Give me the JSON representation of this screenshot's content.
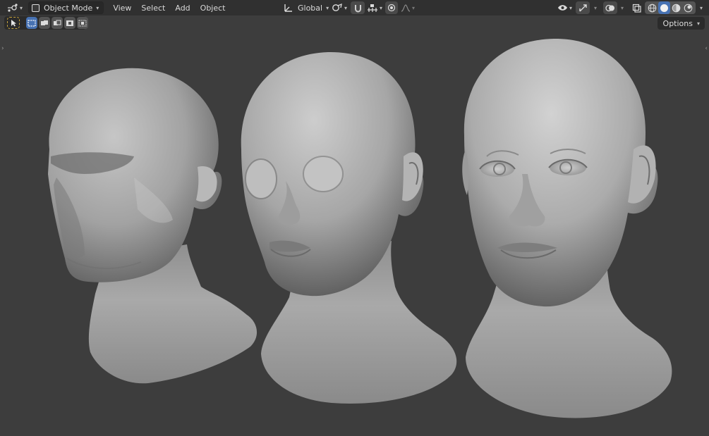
{
  "header": {
    "mode_label": "Object Mode",
    "menu": [
      "View",
      "Select",
      "Add",
      "Object"
    ],
    "transform_orientation": "Global",
    "icons": {
      "editor_type": "object-data-icon",
      "snap": "link-icon",
      "proportional": "circle-dot-icon",
      "visibility": "eye-icon",
      "gizmo": "gizmo-icon",
      "overlay": "overlay-icon",
      "xray": "xray-icon"
    },
    "shading_modes": [
      "wireframe",
      "solid",
      "material-preview",
      "rendered"
    ],
    "active_shading": "solid"
  },
  "toolbar": {
    "options_label": "Options",
    "select_modes": [
      "new",
      "extend",
      "subtract",
      "invert",
      "intersect"
    ]
  },
  "viewport": {
    "models": [
      "low-res-head",
      "mid-res-head",
      "high-res-head"
    ],
    "colors": {
      "background": "#3d3d3d",
      "header": "#303030",
      "accent": "#4772b3"
    }
  }
}
